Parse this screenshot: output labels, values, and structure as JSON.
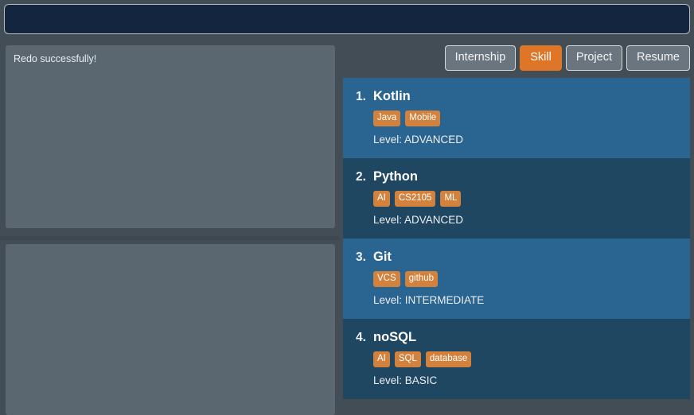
{
  "header": {
    "title": ""
  },
  "colors": {
    "app_background": "#434d55",
    "header_bar": "#14253f",
    "panel": "#5a6771",
    "accent_orange": "#df7526",
    "tag_orange": "#d2823c",
    "card_light_blue": "#2a6490",
    "card_dark_blue": "#1f4762"
  },
  "left": {
    "console": {
      "message": "Redo successfully!"
    },
    "input": {
      "value": "",
      "placeholder": ""
    },
    "splitter_label": "panel-splitter"
  },
  "tabs": [
    {
      "label": "Internship",
      "active": false
    },
    {
      "label": "Skill",
      "active": true
    },
    {
      "label": "Project",
      "active": false
    },
    {
      "label": "Resume",
      "active": false
    }
  ],
  "skills": [
    {
      "index": "1.",
      "name": "Kotlin",
      "tags": [
        "Java",
        "Mobile"
      ],
      "level": "Level: ADVANCED"
    },
    {
      "index": "2.",
      "name": "Python",
      "tags": [
        "AI",
        "CS2105",
        "ML"
      ],
      "level": "Level: ADVANCED"
    },
    {
      "index": "3.",
      "name": "Git",
      "tags": [
        "VCS",
        "github"
      ],
      "level": "Level: INTERMEDIATE"
    },
    {
      "index": "4.",
      "name": "noSQL",
      "tags": [
        "AI",
        "SQL",
        "database"
      ],
      "level": "Level: BASIC"
    }
  ]
}
